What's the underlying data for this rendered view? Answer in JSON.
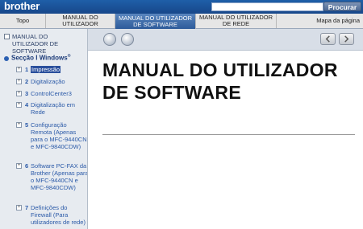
{
  "brand": {
    "logo": "brother"
  },
  "search": {
    "placeholder": "",
    "button_label": "Procurar"
  },
  "tabs": [
    {
      "label": "Topo"
    },
    {
      "label": "MANUAL DO UTILIZADOR"
    },
    {
      "label": "MANUAL DO UTILIZADOR DE SOFTWARE"
    },
    {
      "label": "MANUAL DO UTILIZADOR DE REDE"
    },
    {
      "label": "Mapa da página"
    }
  ],
  "sidebar": {
    "top_link": "MANUAL DO UTILIZADOR DE SOFTWARE",
    "section": {
      "title": "Secção I Windows",
      "sup": "®"
    },
    "items": [
      {
        "num": "1",
        "label": "Impressão",
        "selected": true
      },
      {
        "num": "2",
        "label": "Digitalização"
      },
      {
        "num": "3",
        "label": "ControlCenter3"
      },
      {
        "num": "4",
        "label": "Digitalização em Rede"
      },
      {
        "num": "5",
        "label": "Configuração Remota (Apenas para o MFC-9440CN e MFC-9840CDW)"
      },
      {
        "num": "6",
        "label": "Software PC-FAX da Brother (Apenas para o MFC-9440CN e MFC-9840CDW)"
      },
      {
        "num": "7",
        "label": "Definições do Firewall (Para utilizadores de rede)"
      }
    ]
  },
  "content": {
    "title": "MANUAL DO UTILIZADOR DE SOFTWARE"
  },
  "colors": {
    "brand_blue": "#1f5fa8",
    "active_tab": "#3e6aa8",
    "link": "#2b5aa8"
  }
}
